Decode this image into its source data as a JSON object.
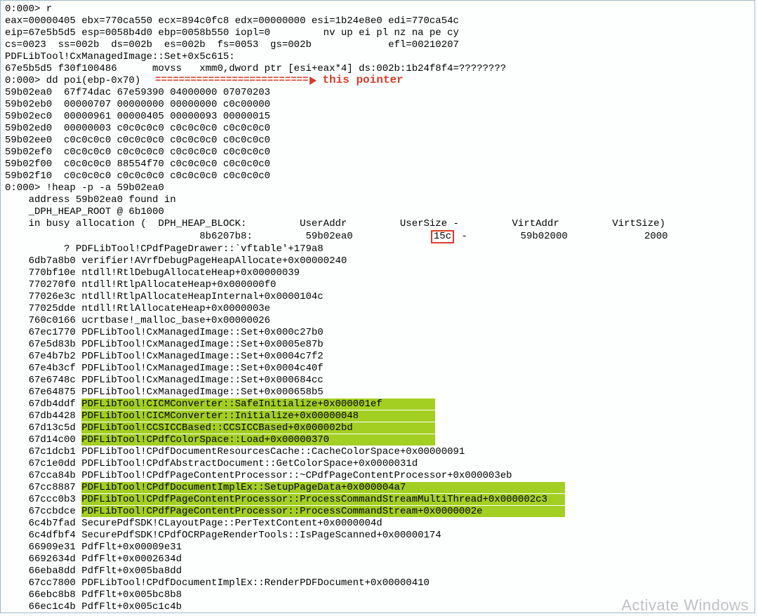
{
  "annotation": {
    "dash_segment": "==========================",
    "label": "this pointer"
  },
  "watermark": "Activate Windows",
  "heap_box_value": "15c",
  "lines": [
    {
      "t": "0:000> r"
    },
    {
      "t": "eax=00000405 ebx=770ca550 ecx=894c0fc8 edx=00000000 esi=1b24e8e0 edi=770ca54c"
    },
    {
      "t": "eip=67e5b5d5 esp=0058b4d0 ebp=0058b550 iopl=0         nv up ei pl nz na pe cy"
    },
    {
      "t": "cs=0023  ss=002b  ds=002b  es=002b  fs=0053  gs=002b             efl=00210207"
    },
    {
      "t": "PDFLibTool!CxManagedImage::Set+0x5c615:"
    },
    {
      "t": "67e5b5d5 f30f100486      movss   xmm0,dword ptr [esi+eax*4] ds:002b:1b24f8f4=????????"
    },
    {
      "t": "0:000> dd poi(ebp-0x70)"
    },
    {
      "t": "59b02ea0  67f74dac 67e59390 04000000 07070203"
    },
    {
      "t": "59b02eb0  00000707 00000000 00000000 c0c00000"
    },
    {
      "t": "59b02ec0  00000961 00000405 00000093 00000015"
    },
    {
      "t": "59b02ed0  00000003 c0c0c0c0 c0c0c0c0 c0c0c0c0"
    },
    {
      "t": "59b02ee0  c0c0c0c0 c0c0c0c0 c0c0c0c0 c0c0c0c0"
    },
    {
      "t": "59b02ef0  c0c0c0c0 c0c0c0c0 c0c0c0c0 c0c0c0c0"
    },
    {
      "t": "59b02f00  c0c0c0c0 88554f70 c0c0c0c0 c0c0c0c0"
    },
    {
      "t": "59b02f10  c0c0c0c0 c0c0c0c0 c0c0c0c0 c0c0c0c0"
    },
    {
      "t": "0:000> !heap -p -a 59b02ea0"
    },
    {
      "t": "    address 59b02ea0 found in"
    },
    {
      "t": "    _DPH_HEAP_ROOT @ 6b1000"
    },
    {
      "t": "    in busy allocation (  DPH_HEAP_BLOCK:         UserAddr         UserSize -         VirtAddr         VirtSize)"
    },
    {
      "t": "HEAP_ROW_SPECIAL"
    },
    {
      "t": "          ? PDFLibTool!CPdfPageDrawer::`vftable'+179a8"
    },
    {
      "t": "    6db7a8b0 verifier!AVrfDebugPageHeapAllocate+0x00000240"
    },
    {
      "t": "    770bf10e ntdll!RtlDebugAllocateHeap+0x00000039"
    },
    {
      "t": "    770270f0 ntdll!RtlpAllocateHeap+0x000000f0"
    },
    {
      "t": "    77026e3c ntdll!RtlpAllocateHeapInternal+0x0000104c"
    },
    {
      "t": "    77025dde ntdll!RtlAllocateHeap+0x0000003e"
    },
    {
      "t": "    760c0166 ucrtbase!_malloc_base+0x00000026"
    },
    {
      "t": "    67ec1770 PDFLibTool!CxManagedImage::Set+0x000c27b0"
    },
    {
      "t": "    67e5d83b PDFLibTool!CxManagedImage::Set+0x0005e87b"
    },
    {
      "t": "    67e4b7b2 PDFLibTool!CxManagedImage::Set+0x0004c7f2"
    },
    {
      "t": "    67e4b3cf PDFLibTool!CxManagedImage::Set+0x0004c40f"
    },
    {
      "t": "    67e6748c PDFLibTool!CxManagedImage::Set+0x000684cc"
    },
    {
      "t": "    67e64875 PDFLibTool!CxManagedImage::Set+0x000658b5"
    },
    {
      "t": "    67db4ddf ",
      "hl": "PDFLibTool!CICMConverter::SafeInitialize+0x000001ef         "
    },
    {
      "t": "    67db4428 ",
      "hl": "PDFLibTool!CICMConverter::Initialize+0x00000048             "
    },
    {
      "t": "    67d13c5d ",
      "hl": "PDFLibTool!CCSICCBased::CCSICCBased+0x000002bd              "
    },
    {
      "t": "    67d14c00 ",
      "hl": "PDFLibTool!CPdfColorSpace::Load+0x00000370                  "
    },
    {
      "t": "    67c1dcb1 PDFLibTool!CPdfDocumentResourcesCache::CacheColorSpace+0x00000091"
    },
    {
      "t": "    67c1e0dd PDFLibTool!CPdfAbstractDocument::GetColorSpace+0x0000031d"
    },
    {
      "t": "    67cca84b PDFLibTool!CPdfPageContentProcessor::~CPdfPageContentProcessor+0x000003eb"
    },
    {
      "t": "    67cc8887 ",
      "hl": "PDFLibTool!CPdfDocumentImplEx::SetupPageData+0x000004a7                           "
    },
    {
      "t": "    67ccc0b3 ",
      "hl": "PDFLibTool!CPdfPageContentProcessor::ProcessCommandStreamMultiThread+0x000002c3   "
    },
    {
      "t": "    67ccbdce ",
      "hl": "PDFLibTool!CPdfPageContentProcessor::ProcessCommandStream+0x0000002e              "
    },
    {
      "t": "    6c4b7fad SecurePdfSDK!CLayoutPage::PerTextContent+0x0000004d"
    },
    {
      "t": "    6c4dfbf4 SecurePdfSDK!CPdfOCRPageRenderTools::IsPageScanned+0x00000174"
    },
    {
      "t": "    66909e31 PdfFlt+0x00009e31"
    },
    {
      "t": "    6692634d PdfFlt+0x0002634d"
    },
    {
      "t": "    66eba8dd PdfFlt+0x005ba8dd"
    },
    {
      "t": "    67cc7800 PDFLibTool!CPdfDocumentImplEx::RenderPDFDocument+0x00000410"
    },
    {
      "t": "    66ebc8b8 PdfFlt+0x005bc8b8"
    },
    {
      "t": "    66ec1c4b PdfFlt+0x005c1c4b"
    }
  ],
  "heap_row": {
    "prefix": "                                 8b6207b8:         59b02ea0             ",
    "mid": " -         59b02000             2000"
  }
}
